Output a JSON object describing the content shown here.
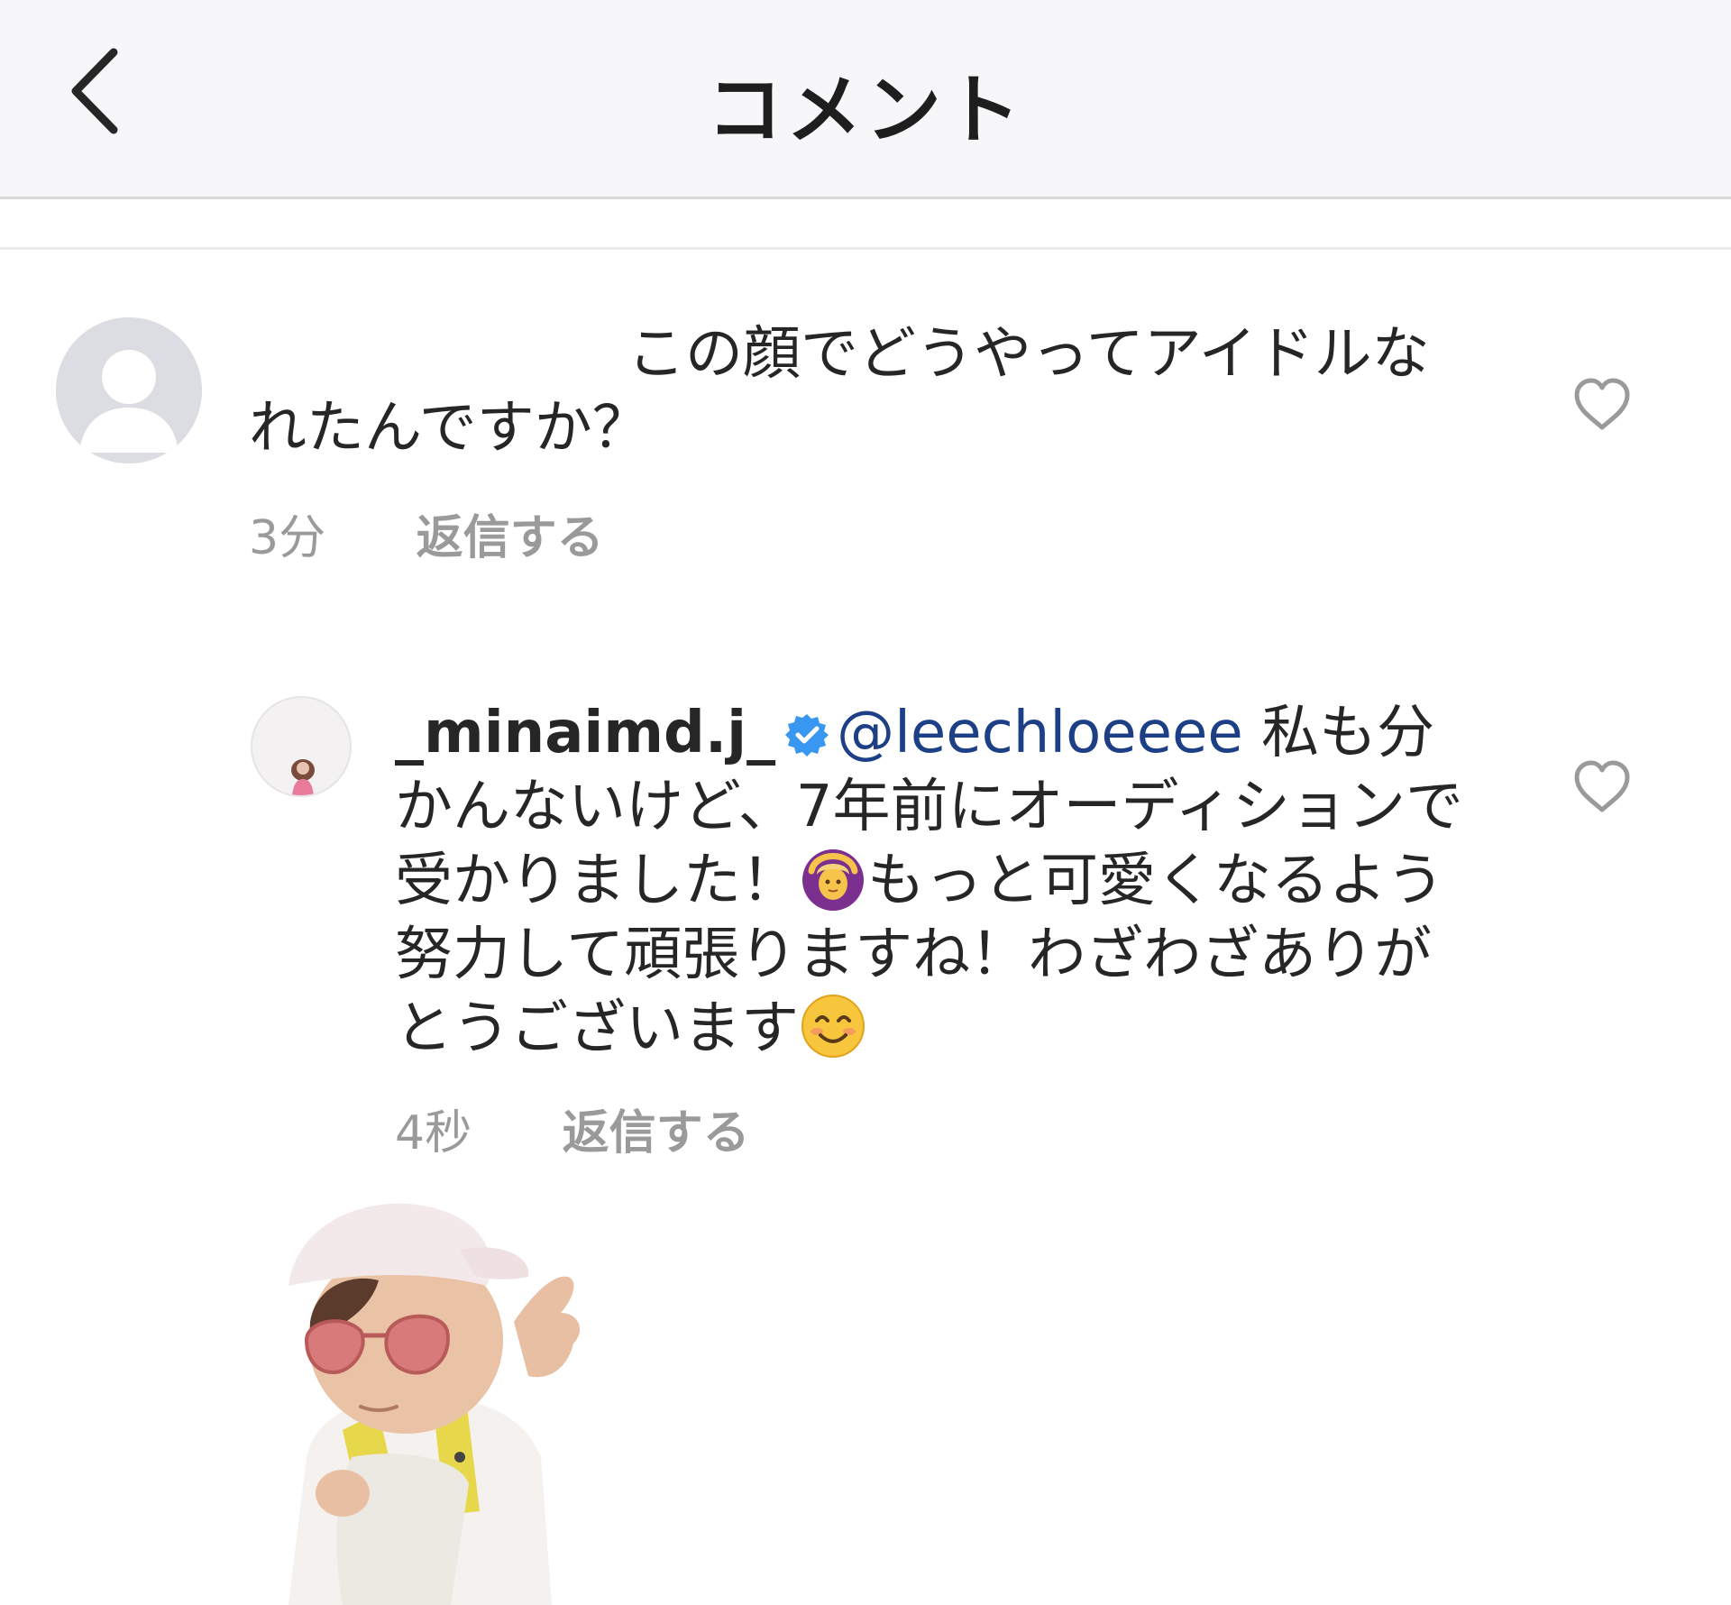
{
  "header": {
    "title": "コメント",
    "back_icon": "chevron-left-icon"
  },
  "comments": [
    {
      "avatar": "default-user-avatar",
      "text": "この顔でどうやってアイドルなれたんですか？",
      "time": "3分",
      "reply_label": "返信する",
      "liked": false
    },
    {
      "avatar": "user-avatar",
      "username": "_minaimd.j_",
      "verified": true,
      "mention": "@leechloeeee",
      "text_part1": " 私も分かんないけど、7年前にオーディションで受かりました！",
      "emoji1": "woman-gesturing-ok-emoji",
      "text_part2": "もっと可愛くなるよう努力して頑張りますね！わざわざありがとうございます",
      "emoji2": "smiling-face-emoji",
      "time": "4秒",
      "reply_label": "返信する",
      "liked": false
    }
  ],
  "colors": {
    "header_bg": "#f7f6f8",
    "text": "#262626",
    "meta_text": "#9a9a9a",
    "mention": "#1d3f86",
    "verified_badge": "#3897f0"
  }
}
